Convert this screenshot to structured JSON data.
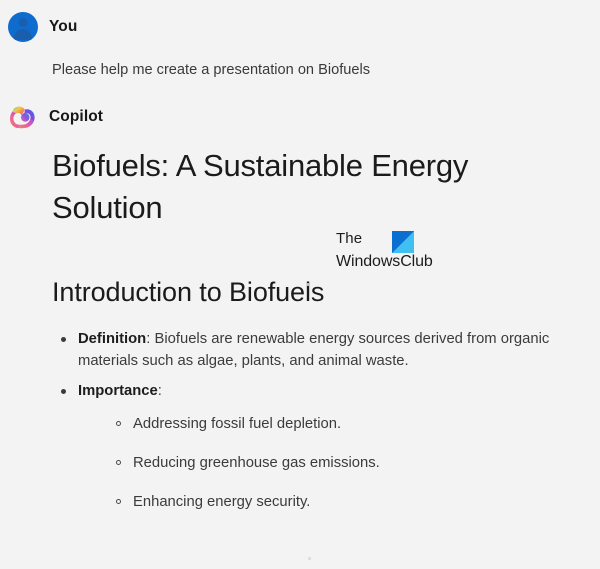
{
  "app": {
    "background_color": "#f3f3f3",
    "accent_color": "#0f6cce"
  },
  "messages": [
    {
      "role": "user",
      "sender_name": "You",
      "avatar_icon": "user-avatar-icon",
      "text": "Please help me create a presentation on Biofuels"
    },
    {
      "role": "assistant",
      "sender_name": "Copilot",
      "avatar_icon": "copilot-logo-icon"
    }
  ],
  "response": {
    "deck_title": "Biofuels: A Sustainable Energy Solution",
    "section_heading": "Introduction to Biofuels",
    "bullets": [
      {
        "term": "Definition",
        "separator": ":",
        "text": " Biofuels are renewable energy sources derived from organic materials such as algae, plants, and animal waste.",
        "sub_bullets": []
      },
      {
        "term": "Importance",
        "separator": ":",
        "text": "",
        "sub_bullets": [
          "Addressing fossil fuel depletion.",
          "Reducing greenhouse gas emissions.",
          "Enhancing energy security."
        ]
      }
    ]
  },
  "watermark": {
    "line1": "The",
    "line2": "WindowsClub",
    "logo_icon": "windowsclub-logo-icon",
    "logo_color_dark": "#0b6fd0",
    "logo_color_light": "#3fc0f0"
  }
}
